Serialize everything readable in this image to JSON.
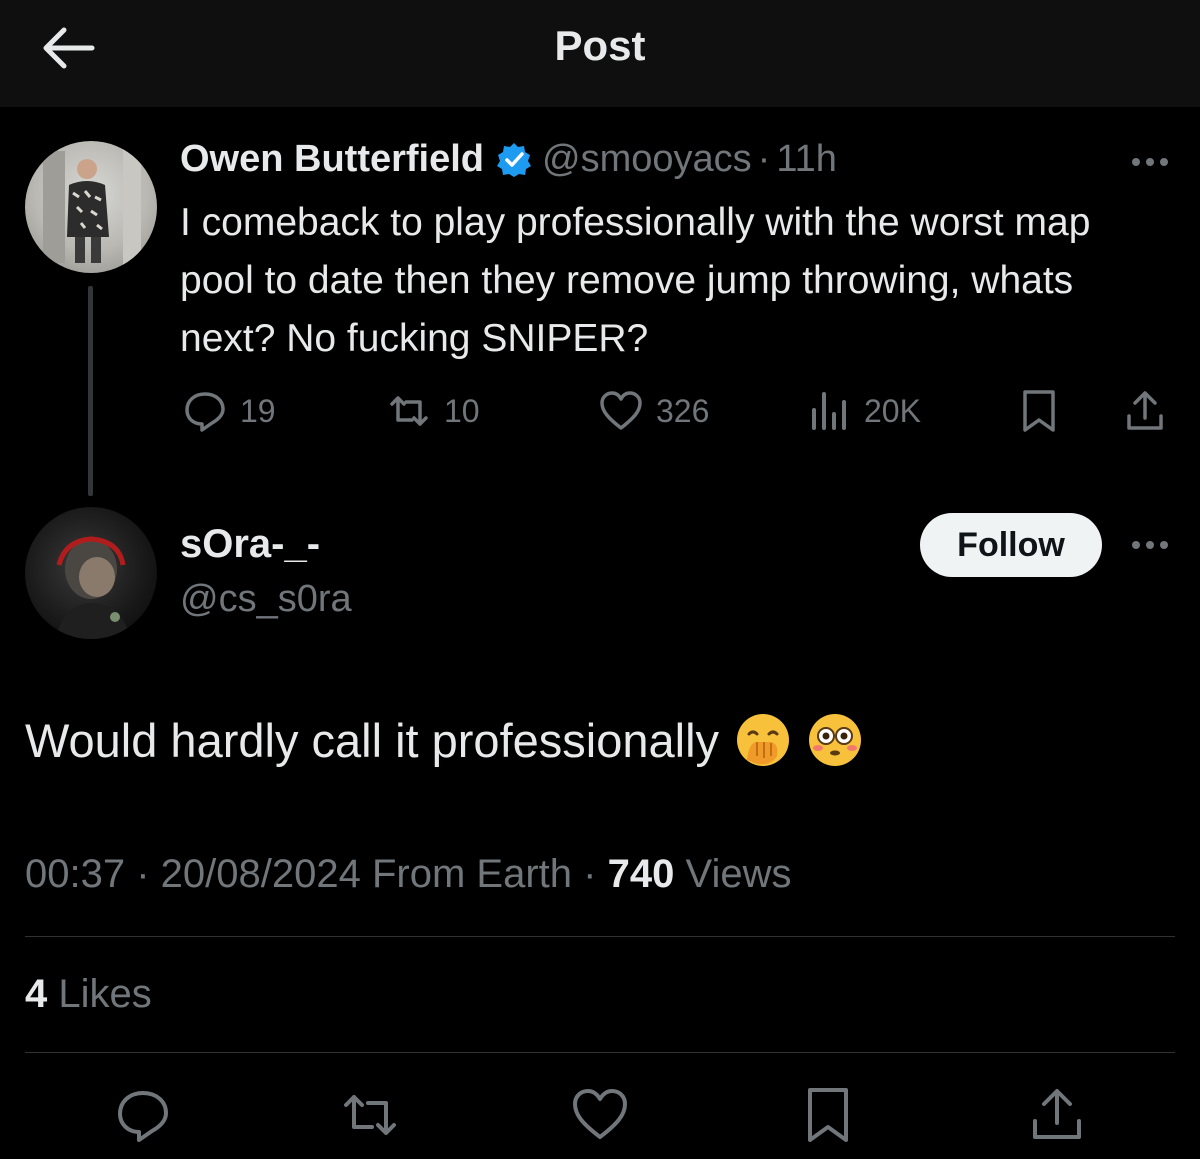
{
  "header": {
    "title": "Post",
    "back_icon": "arrow-left-icon"
  },
  "parent_post": {
    "author_name": "Owen Butterfield",
    "handle": "@smooyacs",
    "time": "11h",
    "separator": "·",
    "verified_color": "#1d9bf0",
    "text": "I comeback to play professionally with the worst map pool to date then they remove jump throwing, whats next? No fucking SNIPER?",
    "stats": {
      "replies": "19",
      "reposts": "10",
      "likes": "326",
      "views": "20K"
    }
  },
  "reply_post": {
    "author_name": "sOra-_-",
    "handle": "@cs_s0ra",
    "follow_label": "Follow",
    "text": "Would hardly call it professionally",
    "emojis": [
      "face-with-hand-over-mouth-icon",
      "flushed-face-icon"
    ],
    "time": "00:37",
    "date": "20/08/2024",
    "location": "From Earth",
    "views_count": "740",
    "views_label": "Views",
    "likes_count": "4",
    "likes_label": "Likes"
  },
  "colors": {
    "background": "#000000",
    "header_bg": "#0f0f0f",
    "text_primary": "#e7e9ea",
    "text_secondary": "#71767b",
    "divider": "#2f3336",
    "follow_bg": "#eff3f4"
  }
}
